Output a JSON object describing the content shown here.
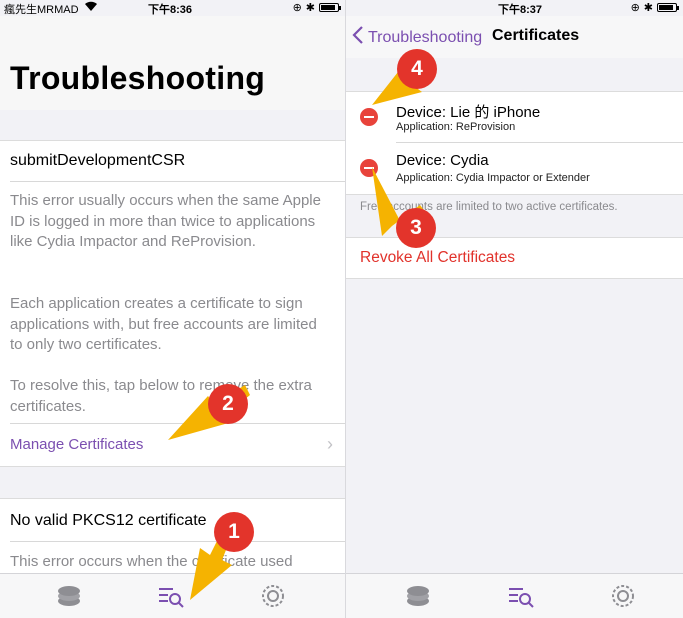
{
  "left": {
    "status": {
      "carrier": "瘋先生MRMAD",
      "time": "下午8:36",
      "battery_level": 0.85
    },
    "title": "Troubleshooting",
    "section1": {
      "title": "submitDevelopmentCSR",
      "paragraphs": [
        "This error usually occurs when the same Apple ID is logged in more than twice to applications like Cydia Impactor and ReProvision.",
        "Each application creates a certificate to sign applications with, but free accounts are limited to only two certificates.",
        "To resolve this, tap below to remove the extra certificates."
      ],
      "link": "Manage Certificates"
    },
    "section2": {
      "title": "No valid PKCS12 certificate",
      "paragraph": "This error occurs when the certificate used"
    },
    "tabbar": {
      "icons": [
        "layers-icon",
        "search-list-icon",
        "gear-icon"
      ]
    }
  },
  "right": {
    "status": {
      "time": "下午8:37",
      "battery_level": 0.85
    },
    "nav": {
      "back_label": "Troubleshooting",
      "title": "Certificates"
    },
    "certificates": [
      {
        "device": "Device: Lie 的 iPhone",
        "application": "Application: ReProvision"
      },
      {
        "device": "Device: Cydia",
        "application": "Application: Cydia Impactor or Extender"
      }
    ],
    "note": "Free accounts are limited to two active certificates.",
    "revoke": "Revoke All Certificates"
  },
  "annotations": {
    "badges": [
      "1",
      "2",
      "3",
      "4"
    ],
    "colors": {
      "badge": "#e3342b",
      "arrow": "#f5b301",
      "accent": "#7b4fb0",
      "destructive": "#e1322b"
    }
  }
}
